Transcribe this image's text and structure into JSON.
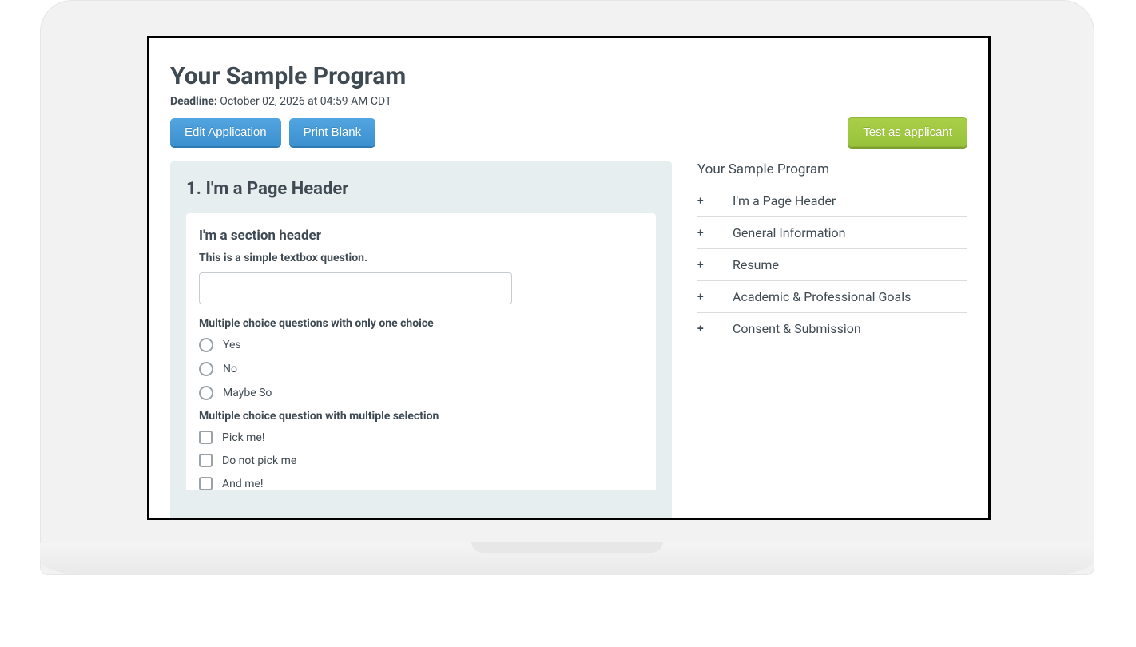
{
  "header": {
    "title": "Your Sample Program",
    "deadline_label": "Deadline:",
    "deadline_value": "October 02, 2026 at 04:59 AM CDT"
  },
  "buttons": {
    "edit": "Edit Application",
    "print": "Print Blank",
    "test": "Test as applicant"
  },
  "page": {
    "number_prefix": "1.",
    "header": "I'm a Page Header"
  },
  "section": {
    "header": "I'm a section header"
  },
  "questions": {
    "textbox_label": "This is a simple textbox question.",
    "radio_label": "Multiple choice questions with only one choice",
    "radio_options": [
      "Yes",
      "No",
      "Maybe So"
    ],
    "checkbox_label": "Multiple choice question with multiple selection",
    "checkbox_options": [
      "Pick me!",
      "Do not pick me",
      "And me!"
    ]
  },
  "sidebar": {
    "title": "Your Sample Program",
    "items": [
      {
        "label": "I'm a Page Header"
      },
      {
        "label": "General Information"
      },
      {
        "label": "Resume"
      },
      {
        "label": "Academic & Professional Goals"
      },
      {
        "label": "Consent & Submission"
      }
    ]
  },
  "icons": {
    "plus": "+"
  }
}
